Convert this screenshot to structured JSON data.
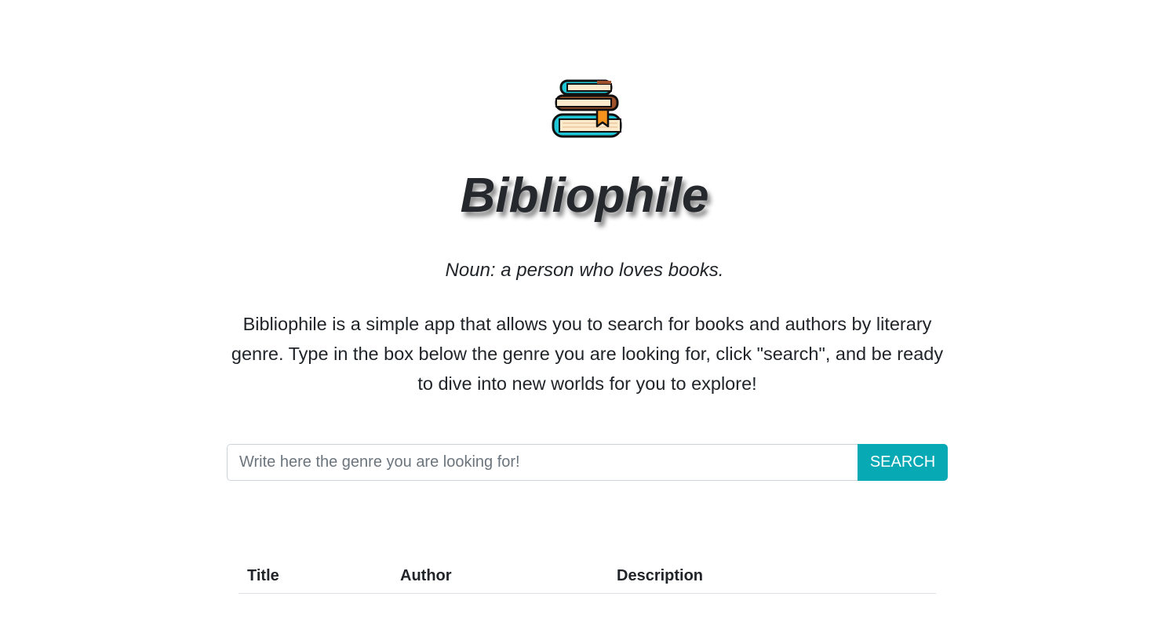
{
  "app": {
    "title": "Bibliophile",
    "logo_icon": "book-stack-icon",
    "definition": "Noun: a person who loves books.",
    "intro": "Bibliophile is a simple app that allows you to search for books and authors by literary genre. Type in the box below the genre you are looking for, click \"search\", and be ready to dive into new worlds for you to explore!"
  },
  "search": {
    "placeholder": "Write here the genre you are looking for!",
    "value": "",
    "button_label": "SEARCH"
  },
  "table": {
    "columns": [
      "Title",
      "Author",
      "Description"
    ],
    "rows": []
  },
  "colors": {
    "accent": "#06a9b4",
    "title_text": "#25282c",
    "book_teal": "#1ec6d6",
    "book_brown": "#a0522d",
    "book_orange": "#f5931f",
    "page_cream": "#fde9cc"
  }
}
